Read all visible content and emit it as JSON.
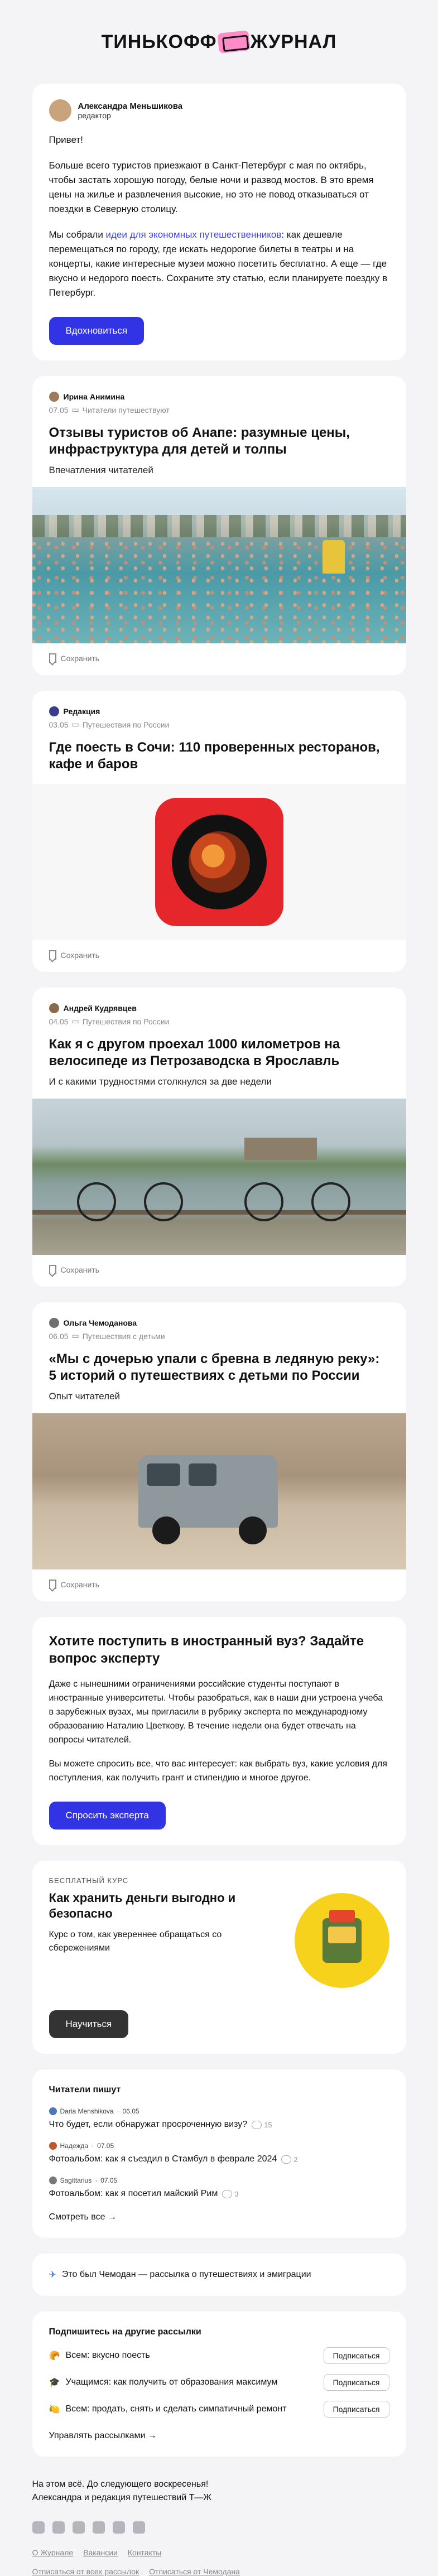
{
  "header": {
    "logo_left": "ТИНЬКОФФ",
    "logo_right": "ЖУРНАЛ"
  },
  "intro": {
    "author_name": "Александра Меньшикова",
    "author_role": "редактор",
    "greeting": "Привет!",
    "para1": "Больше всего туристов приезжают в Санкт-Петербург с мая по октябрь, чтобы застать хорошую погоду, белые ночи и развод мостов. В это время цены на жилье и развлечения высокие, но это не повод отказываться от поездки в Северную столицу.",
    "para2_pre": "Мы собрали ",
    "para2_link": "идеи для экономных путешественников",
    "para2_post": ": как дешевле перемещаться по городу, где искать недорогие билеты в театры и на концерты, какие интересные музеи можно посетить бесплатно. А еще — где вкусно и недорого поесть. Сохраните эту статью, если планируете поездку в Петербург.",
    "button": "Вдохновиться"
  },
  "articles": [
    {
      "author": "Ирина Анимина",
      "date": "07.05",
      "section": "Читатели путешествуют",
      "title": "Отзывы туристов об Анапе: разумные цены, инфраструктура для детей и толпы",
      "lead": "Впечатления читателей",
      "save": "Сохранить"
    },
    {
      "author": "Редакция",
      "date": "03.05",
      "section": "Путешествия по России",
      "title": "Где поесть в Сочи: 110 проверенных ресторанов, кафе и баров",
      "lead": "",
      "save": "Сохранить"
    },
    {
      "author": "Андрей Кудрявцев",
      "date": "04.05",
      "section": "Путешествия по России",
      "title": "Как я с другом проехал 1000 километров на велосипеде из Петрозаводска в Ярославль",
      "lead": "И с какими трудностями столкнулся за две недели",
      "save": "Сохранить"
    },
    {
      "author": "Ольга Чемоданова",
      "date": "06.05",
      "section": "Путешествия с детьми",
      "title": "«Мы с дочерью упали с бревна в ледяную реку»: 5 историй о путешествиях с детьми по России",
      "lead": "Опыт читателей",
      "save": "Сохранить"
    }
  ],
  "question": {
    "title": "Хотите поступить в иностранный вуз? Задайте вопрос эксперту",
    "p1": "Даже с нынешними ограничениями российские студенты поступают в иностранные университеты. Чтобы разобраться, как в наши дни устроена учеба в зарубежных вузах, мы пригласили в рубрику эксперта по международному образованию Наталию Цветкову. В течение недели она будет отвечать на вопросы читателей.",
    "p2": "Вы можете спросить все, что вас интересует: как выбрать вуз, какие условия для поступления, как получить грант и стипендию и многое другое.",
    "button": "Спросить эксперта"
  },
  "course": {
    "kicker": "БЕСПЛАТНЫЙ КУРС",
    "title": "Как хранить деньги выгодно и безопасно",
    "desc": "Курс о том, как увереннее обращаться со сбережениями",
    "button": "Научиться"
  },
  "readers": {
    "title": "Читатели пишут",
    "items": [
      {
        "user": "Daria Menshikova",
        "date": "06.05",
        "text": "Что будет, если обнаружат просроченную визу?",
        "count": "15"
      },
      {
        "user": "Надежда",
        "date": "07.05",
        "text": "Фотоальбом: как я съездил в Стамбул в феврале 2024",
        "count": "2"
      },
      {
        "user": "Sagittarius",
        "date": "07.05",
        "text": "Фотоальбом: как я посетил майский Рим",
        "count": "3"
      }
    ],
    "more": "Смотреть все →"
  },
  "chemodan": {
    "text": "Это был Чемодан — рассылка о путешествиях и эмиграции"
  },
  "subscriptions": {
    "title": "Подпишитесь на другие рассылки",
    "items": [
      {
        "emoji": "🥐",
        "label": "Всем: вкусно поесть",
        "button": "Подписаться"
      },
      {
        "emoji": "🎓",
        "label": "Учащимся: как получить от образования максимум",
        "button": "Подписаться"
      },
      {
        "emoji": "🍋",
        "label": "Всем: продать, снять и сделать симпатичный ремонт",
        "button": "Подписаться"
      }
    ],
    "manage": "Управлять рассылками →"
  },
  "footer": {
    "line1": "На этом всё. До следующего воскресенья!",
    "line2": "Александра и редакция путешествий Т—Ж",
    "links": [
      "О Журнале",
      "Вакансии",
      "Контакты"
    ],
    "unsub_all": "Отписаться от всех рассылок",
    "unsub_one": "Отписаться от Чемодана"
  }
}
